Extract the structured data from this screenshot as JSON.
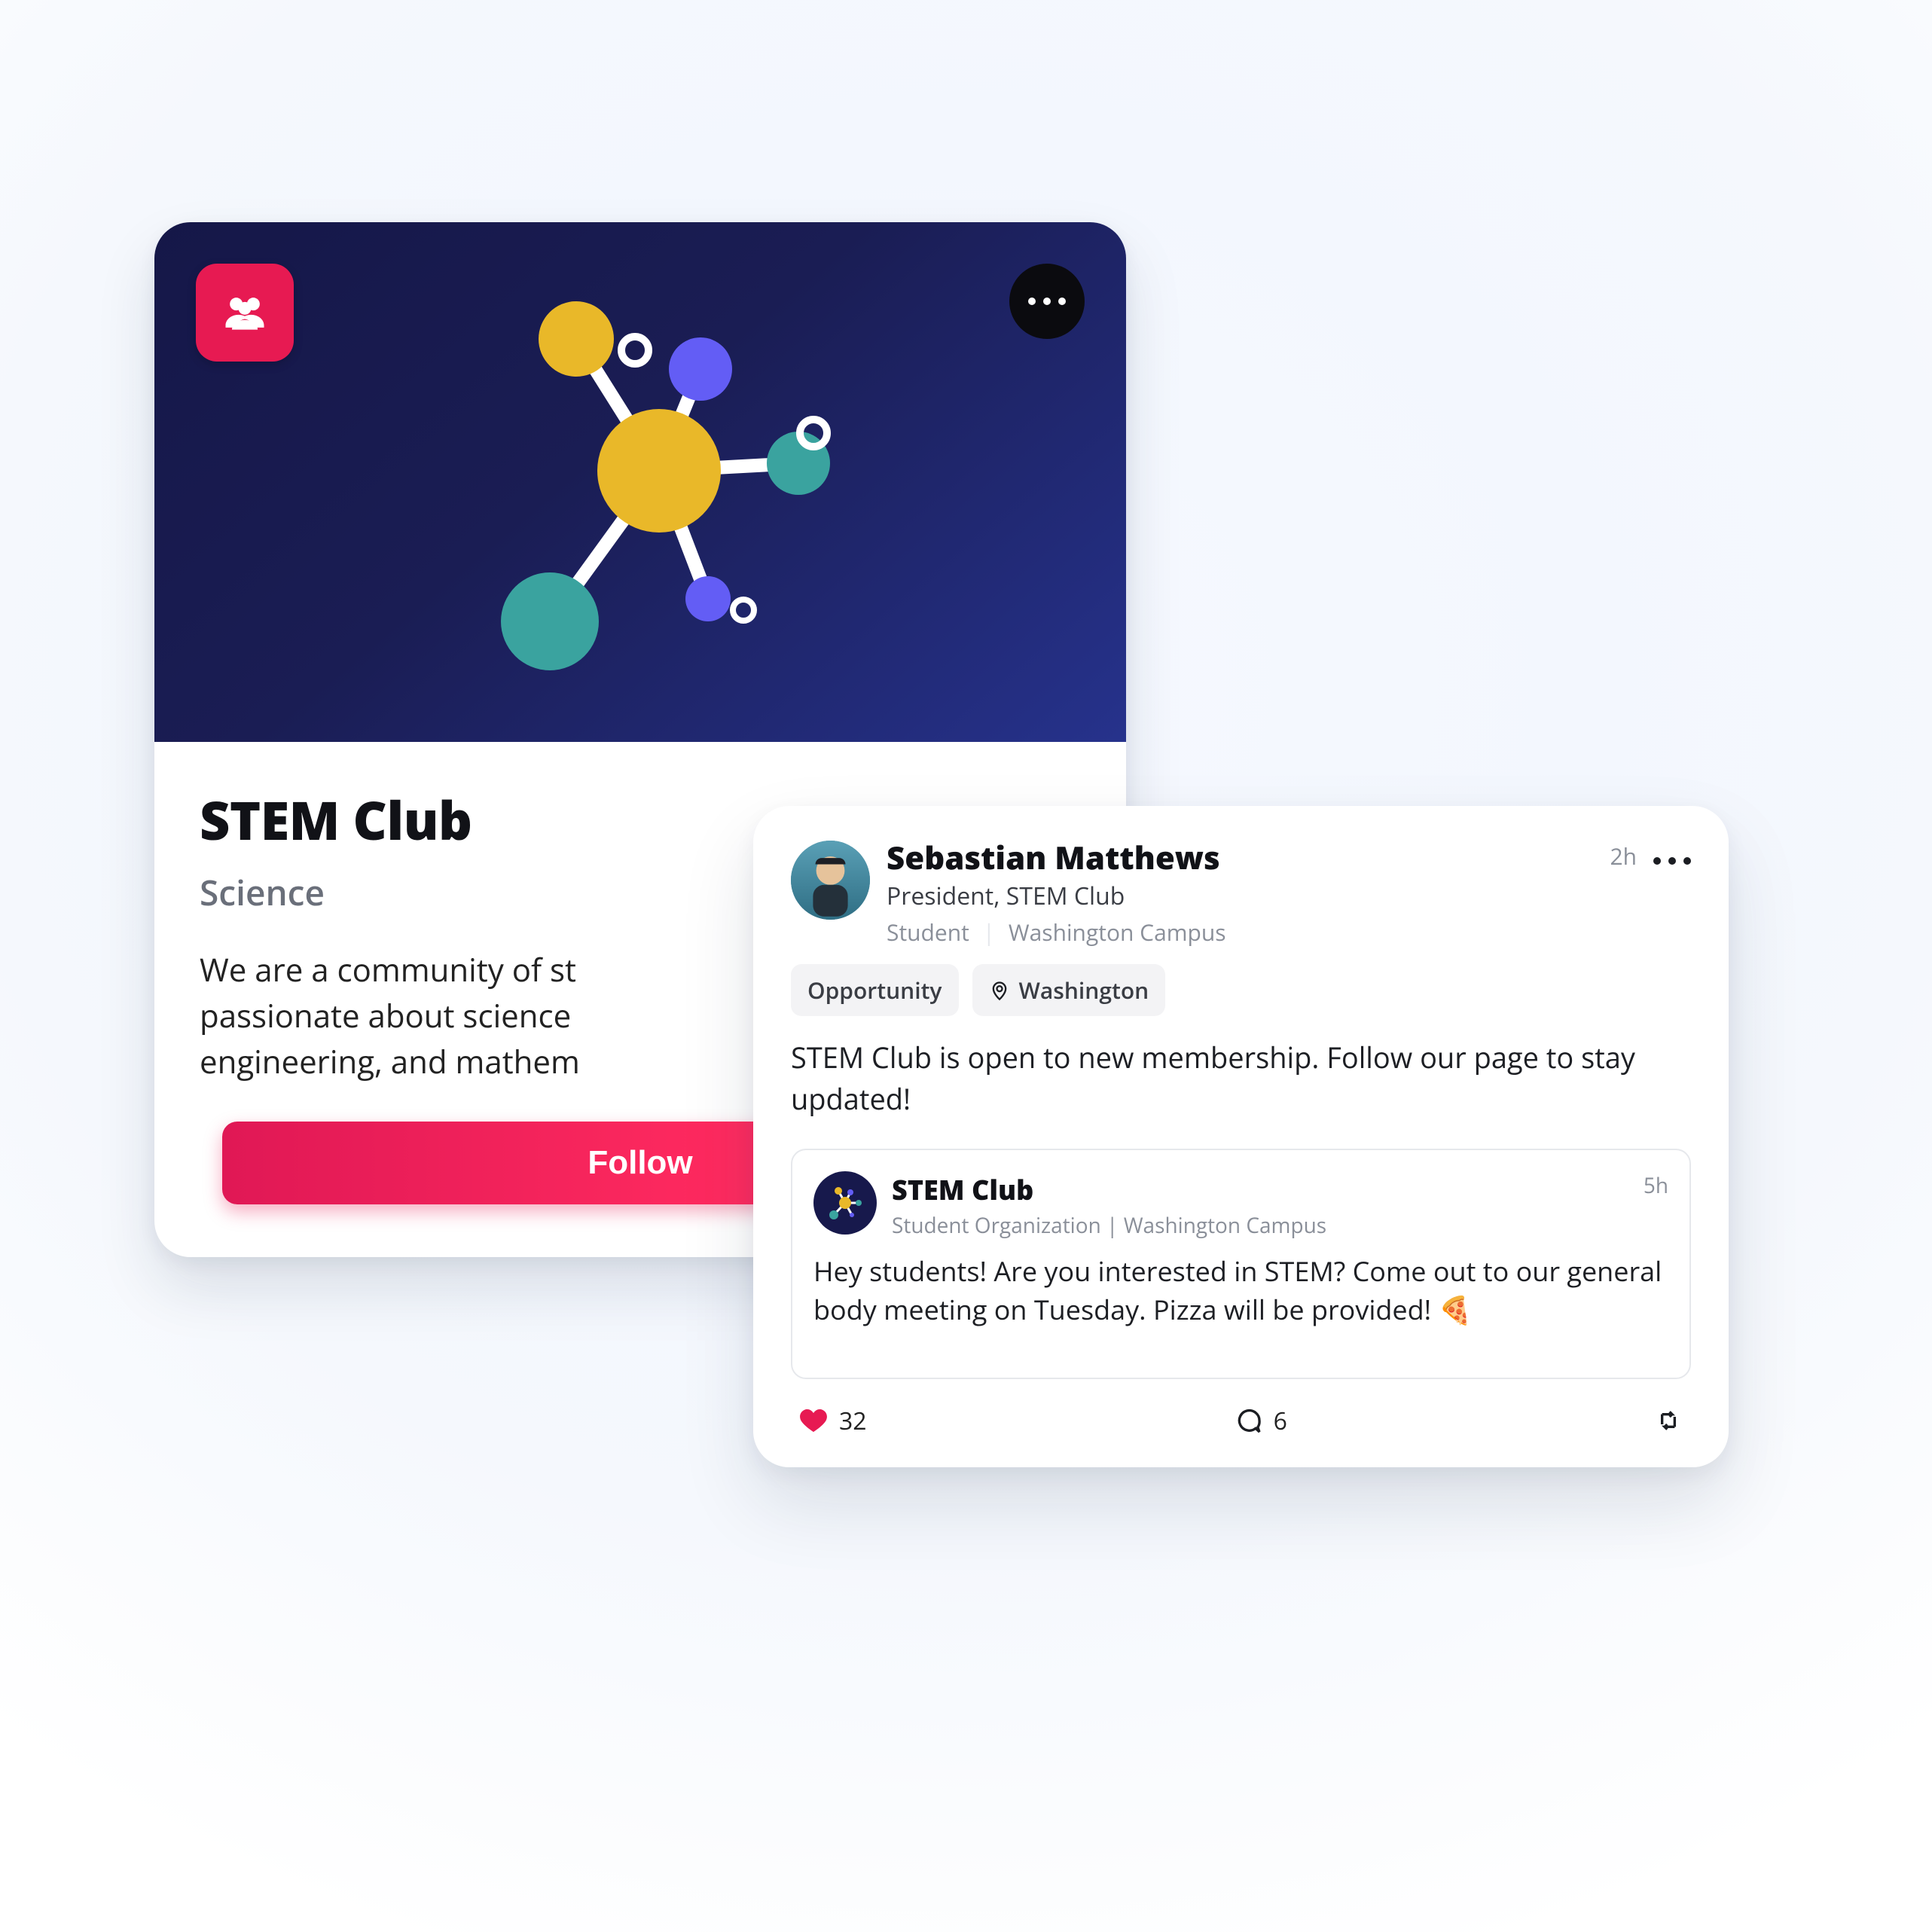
{
  "colors": {
    "accent_pink": "#e71a52",
    "navy": "#1a1c4d",
    "teal": "#3aa39f",
    "yellow": "#e9b829",
    "purple": "#635df5"
  },
  "club_card": {
    "badge_icon_name": "group-icon",
    "more_icon_name": "more-icon",
    "title": "STEM Club",
    "topic": "Science",
    "description_visible": "We are a community of st\npassionate about science\nengineering, and mathem",
    "follow_button_label": "Follow"
  },
  "post": {
    "avatar_icon_name": "avatar",
    "author_name": "Sebastian Matthews",
    "author_title": "President, STEM Club",
    "author_role": "Student",
    "author_location": "Washington Campus",
    "time_ago": "2h",
    "chips": [
      {
        "icon": null,
        "label": "Opportunity"
      },
      {
        "icon": "pin-icon",
        "label": "Washington"
      }
    ],
    "body": "STEM Club is open to new membership. Follow our page to stay updated!",
    "quote": {
      "avatar_icon_name": "molecule-icon",
      "name": "STEM Club",
      "subtitle_left": "Student Organization",
      "subtitle_right": "Washington Campus",
      "time_ago": "5h",
      "body": "Hey students! Are you interested in STEM? Come out to our general body meeting on Tuesday. Pizza will be provided! 🍕"
    },
    "actions": {
      "like_count": "32",
      "comment_count": "6"
    }
  }
}
